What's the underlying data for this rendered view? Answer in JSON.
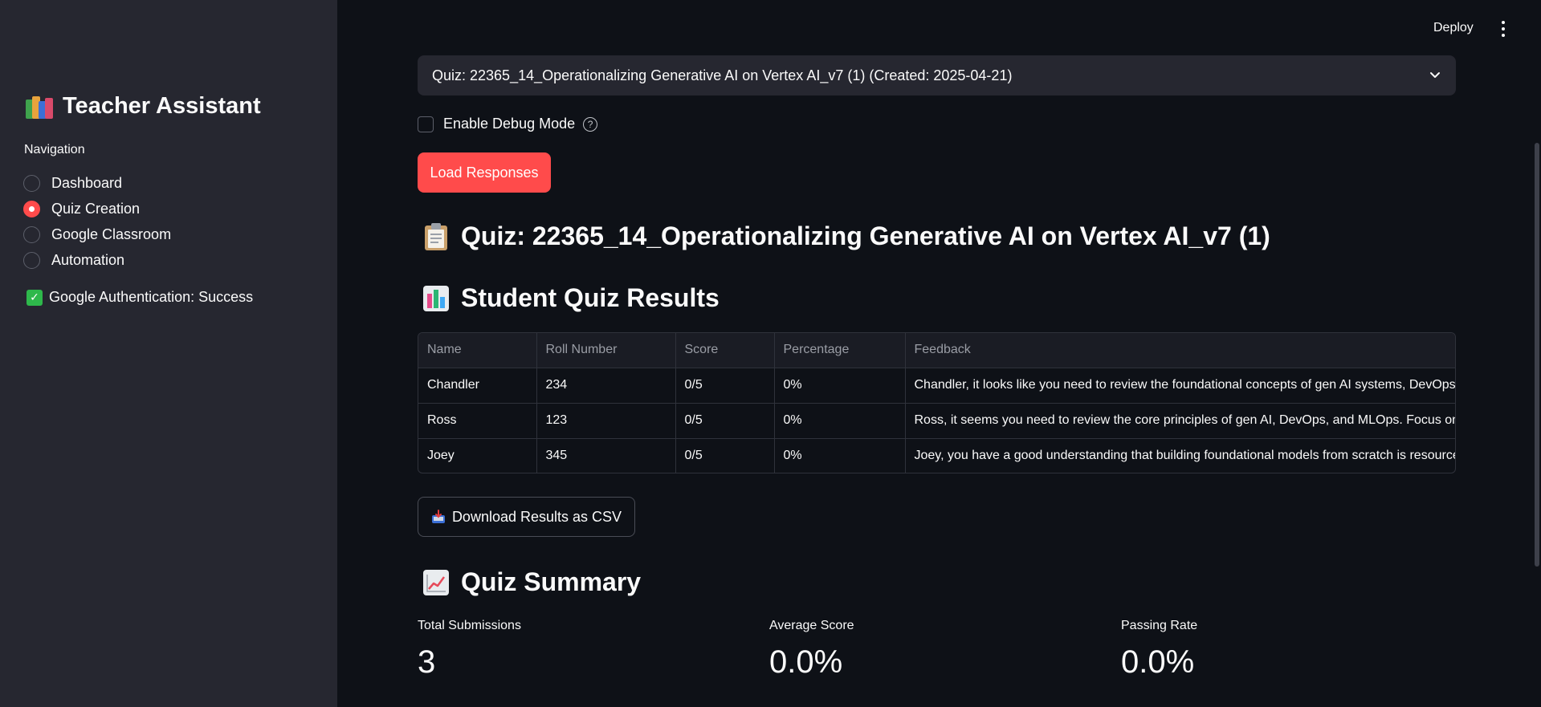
{
  "header": {
    "deploy_label": "Deploy",
    "menu_icon": "kebab-menu-icon"
  },
  "sidebar": {
    "title": "Teacher Assistant",
    "title_icon": "books-icon",
    "nav_label": "Navigation",
    "nav_items": [
      {
        "label": "Dashboard",
        "selected": false
      },
      {
        "label": "Quiz Creation",
        "selected": true
      },
      {
        "label": "Google Classroom",
        "selected": false
      },
      {
        "label": "Automation",
        "selected": false
      }
    ],
    "auth_status": "Google Authentication: Success"
  },
  "main": {
    "quiz_select": {
      "value": "Quiz: 22365_14_Operationalizing Generative AI on Vertex AI_v7 (1) (Created: 2025-04-21)"
    },
    "debug_checkbox": {
      "label": "Enable Debug Mode",
      "checked": false
    },
    "load_button": "Load Responses",
    "quiz_heading": "Quiz: 22365_14_Operationalizing Generative AI on Vertex AI_v7 (1)",
    "results_heading": "Student Quiz Results",
    "table": {
      "columns": [
        "Name",
        "Roll Number",
        "Score",
        "Percentage",
        "Feedback"
      ],
      "rows": [
        [
          "Chandler",
          "234",
          "0/5",
          "0%",
          "Chandler, it looks like you need to review the foundational concepts of gen AI systems, DevOps, and MLOps"
        ],
        [
          "Ross",
          "123",
          "0/5",
          "0%",
          "Ross, it seems you need to review the core principles of gen AI, DevOps, and MLOps. Focus on"
        ],
        [
          "Joey",
          "345",
          "0/5",
          "0%",
          "Joey, you have a good understanding that building foundational models from scratch is resource intensive"
        ]
      ]
    },
    "download_button": "Download Results as CSV",
    "summary_heading": "Quiz Summary",
    "metrics": [
      {
        "label": "Total Submissions",
        "value": "3"
      },
      {
        "label": "Average Score",
        "value": "0.0%"
      },
      {
        "label": "Passing Rate",
        "value": "0.0%"
      }
    ]
  },
  "colors": {
    "accent": "#ff4b4b",
    "sidebar_bg": "#262730",
    "main_bg": "#0e1117",
    "success": "#2eb84b"
  }
}
